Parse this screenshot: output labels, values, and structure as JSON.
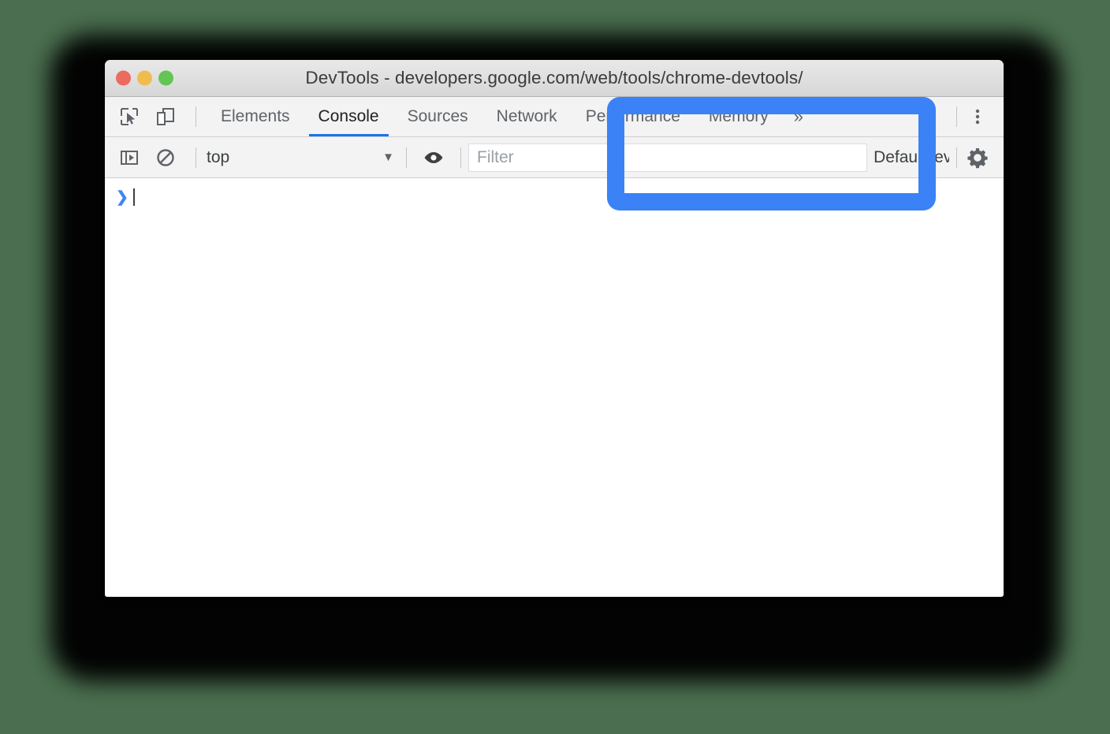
{
  "background": {
    "color": "#4a6e4f"
  },
  "window": {
    "title": "DevTools - developers.google.com/web/tools/chrome-devtools/",
    "traffic_lights": [
      {
        "name": "close",
        "color": "#ec6a5e"
      },
      {
        "name": "minimize",
        "color": "#f0bc4f"
      },
      {
        "name": "maximize",
        "color": "#62c554"
      }
    ]
  },
  "tabstrip": {
    "icons": [
      {
        "name": "inspect-element-icon",
        "title": "Inspect element"
      },
      {
        "name": "device-toolbar-icon",
        "title": "Toggle device toolbar"
      }
    ],
    "tabs": [
      {
        "label": "Elements",
        "active": false
      },
      {
        "label": "Console",
        "active": true
      },
      {
        "label": "Sources",
        "active": false
      },
      {
        "label": "Network",
        "active": false
      },
      {
        "label": "Performance",
        "active": false
      },
      {
        "label": "Memory",
        "active": false
      }
    ],
    "overflow_label": "»",
    "more_options": {
      "name": "more-options-icon",
      "title": "Customize and control DevTools"
    }
  },
  "filterbar": {
    "sidebar_toggle": {
      "name": "console-sidebar-icon",
      "title": "Show console sidebar"
    },
    "clear_console": {
      "name": "clear-console-icon",
      "title": "Clear console"
    },
    "context": {
      "value": "top",
      "caret": "▼"
    },
    "live_expression": {
      "name": "eye-icon",
      "title": "Create live expression"
    },
    "filter": {
      "value": "",
      "placeholder": "Filter"
    },
    "levels": {
      "value": "Default levels",
      "caret": "▼"
    },
    "settings": {
      "name": "gear-icon",
      "title": "Console settings"
    }
  },
  "console": {
    "prompt_chevron": "❯",
    "input_value": ""
  },
  "annotation": {
    "color": "#3b82f6",
    "name": "highlight-box"
  }
}
